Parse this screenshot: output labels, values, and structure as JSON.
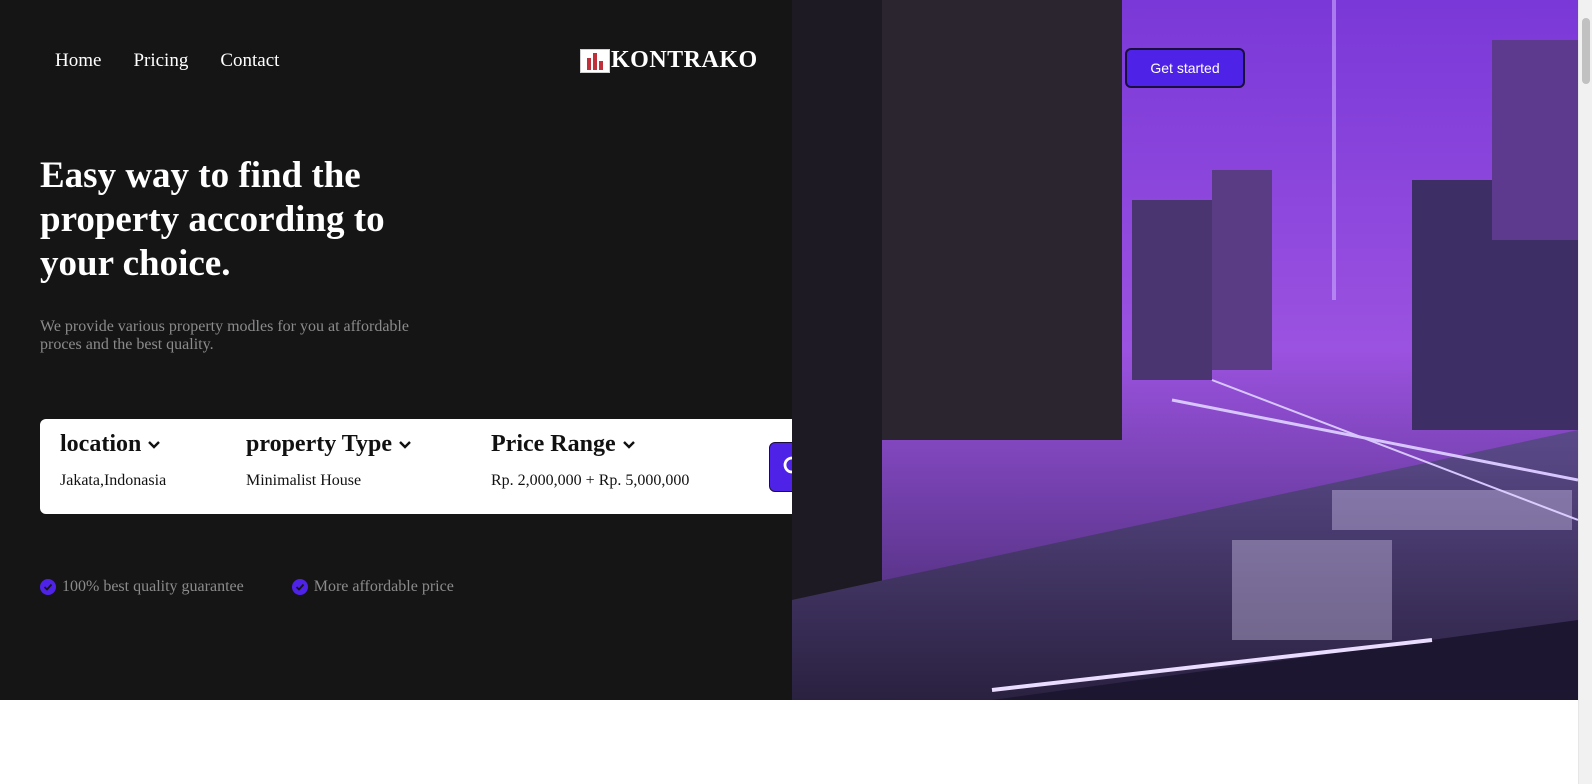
{
  "nav": {
    "items": [
      {
        "label": "Home"
      },
      {
        "label": "Pricing"
      },
      {
        "label": "Contact"
      }
    ]
  },
  "brand": {
    "name": "KONTRAKO",
    "logo_icon": "building-logo-icon"
  },
  "cta": {
    "label": "Get started"
  },
  "hero": {
    "headline": "Easy way to find the property according to your choice.",
    "subtitle": "We provide various property modles for you at affordable proces and the best quality."
  },
  "search": {
    "filters": [
      {
        "label": "location",
        "value": "Jakata,Indonasia"
      },
      {
        "label": "property Type",
        "value": "Minimalist House"
      },
      {
        "label": "Price Range",
        "value": "Rp. 2,000,000 + Rp. 5,000,000"
      }
    ],
    "button_icon": "search-icon"
  },
  "features": [
    {
      "label": "100% best quality guarantee"
    },
    {
      "label": "More affordable price"
    }
  ],
  "colors": {
    "accent": "#4f22e8",
    "dark_background": "#161515",
    "muted_text": "#8b8b8b"
  }
}
